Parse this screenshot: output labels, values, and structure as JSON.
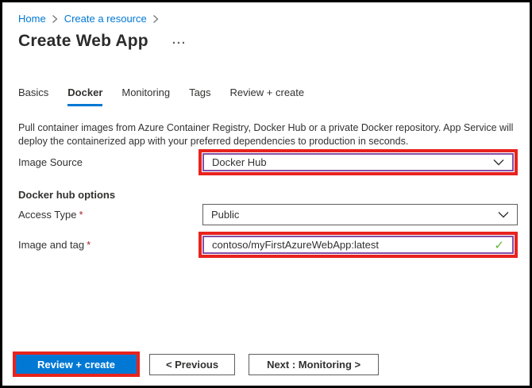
{
  "page": {
    "breadcrumb": {
      "items": [
        {
          "label": "Home"
        },
        {
          "label": "Create a resource"
        }
      ]
    },
    "title": "Create Web App",
    "title_menu_glyph": "···",
    "tabs": [
      {
        "label": "Basics",
        "active": false
      },
      {
        "label": "Docker",
        "active": true
      },
      {
        "label": "Monitoring",
        "active": false
      },
      {
        "label": "Tags",
        "active": false
      },
      {
        "label": "Review + create",
        "active": false
      }
    ],
    "description": "Pull container images from Azure Container Registry, Docker Hub or a private Docker repository. App Service will deploy the containerized app with your preferred dependencies to production in seconds.",
    "form": {
      "image_source": {
        "label": "Image Source",
        "value": "Docker Hub",
        "highlighted": true
      },
      "section_header": "Docker hub options",
      "access_type": {
        "label": "Access Type",
        "required_marker": "*",
        "value": "Public"
      },
      "image_and_tag": {
        "label": "Image and tag",
        "required_marker": "*",
        "value": "contoso/myFirstAzureWebApp:latest",
        "valid": true,
        "check_glyph": "✓"
      }
    },
    "footer": {
      "review_create_label": "Review + create",
      "previous_label": "< Previous",
      "next_label": "Next : Monitoring >"
    },
    "colors": {
      "accent_blue": "#0078d4",
      "highlight_red": "#e8231d",
      "focus_purple": "#8250a4",
      "valid_green": "#62b837",
      "required_red": "#a4262c",
      "text": "#323130"
    }
  }
}
